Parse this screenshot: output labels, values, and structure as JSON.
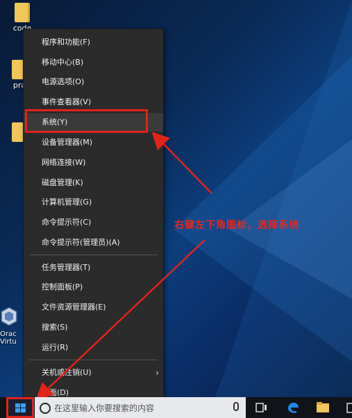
{
  "desktop": {
    "icons": [
      {
        "label": "code"
      },
      {
        "label": "pra"
      },
      {
        "label": ""
      },
      {
        "label": "Orac Virtu"
      }
    ]
  },
  "context_menu": {
    "items": [
      {
        "label": "程序和功能(F)"
      },
      {
        "label": "移动中心(B)"
      },
      {
        "label": "电源选项(O)"
      },
      {
        "label": "事件查看器(V)"
      },
      {
        "label": "系统(Y)"
      },
      {
        "label": "设备管理器(M)"
      },
      {
        "label": "网络连接(W)"
      },
      {
        "label": "磁盘管理(K)"
      },
      {
        "label": "计算机管理(G)"
      },
      {
        "label": "命令提示符(C)"
      },
      {
        "label": "命令提示符(管理员)(A)"
      },
      {
        "label": "任务管理器(T)"
      },
      {
        "label": "控制面板(P)"
      },
      {
        "label": "文件资源管理器(E)"
      },
      {
        "label": "搜索(S)"
      },
      {
        "label": "运行(R)"
      },
      {
        "label": "关机或注销(U)"
      },
      {
        "label": "桌面(D)"
      }
    ],
    "highlighted_item": "系统(Y)",
    "submenu_arrow": "›"
  },
  "annotation": {
    "text": "右键左下角图标，选择系统",
    "color": "#e8261e"
  },
  "taskbar": {
    "search_placeholder": "在这里输入你要搜索的内容",
    "icons": [
      "start-windows-icon",
      "cortana-icon",
      "microphone-icon",
      "task-view-icon",
      "edge-icon",
      "file-explorer-icon",
      "store-icon"
    ]
  }
}
